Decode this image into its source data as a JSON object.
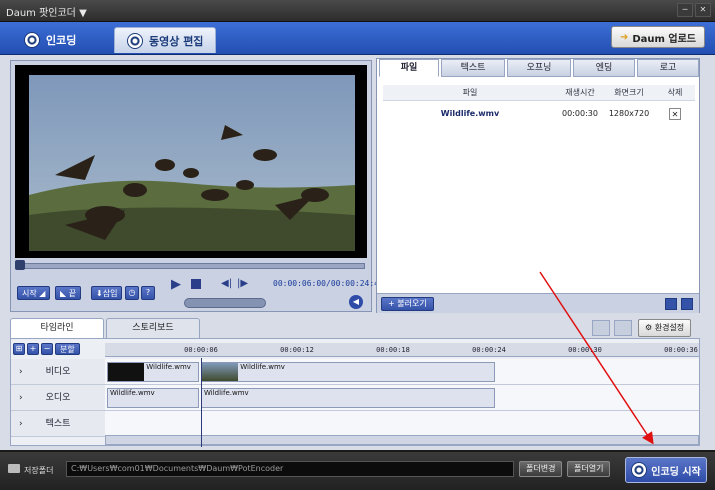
{
  "app": {
    "title": "Daum 팟인코더",
    "title_arrow": "▼"
  },
  "window": {
    "minimize": "─",
    "close": "✕"
  },
  "tabs": {
    "encoding": "인코딩",
    "edit": "동영상 편집"
  },
  "upload": {
    "label": "Daum 업로드"
  },
  "player": {
    "time_current": "00:00:06:00",
    "time_total": "00:00:24:44",
    "sep": "/",
    "start_btn": "시작",
    "end_btn": "끝",
    "insert_btn": "삽입",
    "help_btn": "?",
    "scrub_progress": 0.01
  },
  "right_tabs": [
    "파일",
    "텍스트",
    "오프닝",
    "엔딩",
    "로고"
  ],
  "files": {
    "headers": [
      "파일",
      "재생시간",
      "화면크기",
      "삭제"
    ],
    "rows": [
      {
        "name": "Wildlife.wmv",
        "duration": "00:00:30",
        "size": "1280x720",
        "del": "✕"
      }
    ]
  },
  "load_btn": "불러오기",
  "timeline": {
    "tabs": [
      "타임라인",
      "스토리보드"
    ],
    "split_btn": "분할",
    "settings_btn": "환경설정",
    "ticks": [
      "00:00:06",
      "00:00:12",
      "00:00:18",
      "00:00:24",
      "00:00:30",
      "00:00:36"
    ],
    "tracks": [
      "비디오",
      "오디오",
      "텍스트"
    ],
    "video_clips": [
      "Wildlife.wmv",
      "Wildlife.wmv"
    ],
    "audio_clips": [
      "Wildlife.wmv",
      "Wildlife.wmv"
    ]
  },
  "status": {
    "save_label": "저장폴더",
    "path": "C:₩Users₩com01₩Documents₩Daum₩PotEncoder",
    "change_folder": "폴더변경",
    "open_folder": "폴더열기",
    "start_encode": "인코딩 시작"
  },
  "colors": {
    "accent": "#3453a8",
    "arrow": "#e01010"
  }
}
